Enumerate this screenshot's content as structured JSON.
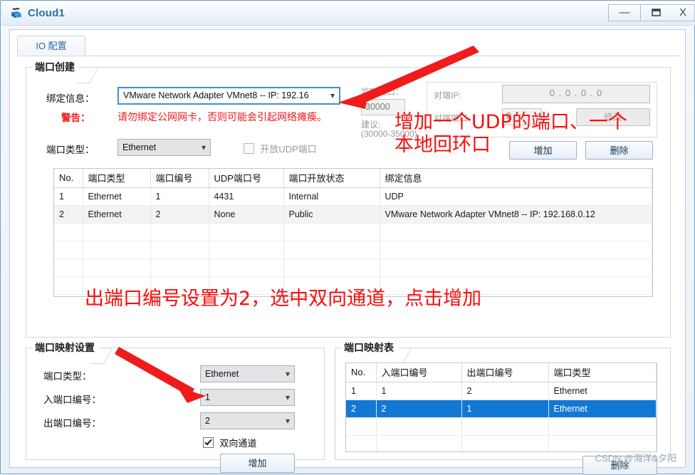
{
  "window": {
    "title": "Cloud1",
    "icon": "cloud-device-icon",
    "minimize_label": "—",
    "maximize_label": "❐",
    "close_label": "X"
  },
  "tabs": [
    {
      "label": "IO 配置",
      "active": true
    }
  ],
  "port_create": {
    "group_title": "端口创建",
    "binding_label": "绑定信息：",
    "binding_value": "VMware Network Adapter VMnet8 -- IP: 192.16",
    "warning_label": "警告：",
    "warning_text": "请勿绑定公网网卡，否则可能会引起网络瘫痪。",
    "port_type_label": "端口类型：",
    "port_type_value": "Ethernet",
    "udp_checkbox_label": "开放UDP端口",
    "udp_checkbox_checked": false,
    "listen_port_label": "监听端口：",
    "listen_port_value": "30000",
    "suggest_label": "建议:",
    "suggest_range": "(30000-35000)",
    "peer_ip_label": "对端IP:",
    "peer_ip_value": "0 . 0 . 0 . 0",
    "peer_port_label": "对端端口:",
    "peer_port_value": "0",
    "modify_button": "修改",
    "add_button": "增加",
    "delete_button": "删除"
  },
  "port_table": {
    "columns": [
      "No.",
      "端口类型",
      "端口编号",
      "UDP端口号",
      "端口开放状态",
      "绑定信息"
    ],
    "rows": [
      [
        "1",
        "Ethernet",
        "1",
        "4431",
        "Internal",
        "UDP"
      ],
      [
        "2",
        "Ethernet",
        "2",
        "None",
        "Public",
        "VMware Network Adapter VMnet8 -- IP: 192.168.0.12"
      ]
    ],
    "empty_rows": 5
  },
  "map_settings": {
    "group_title": "端口映射设置",
    "port_type_label": "端口类型：",
    "port_type_value": "Ethernet",
    "in_port_label": "入端口编号：",
    "in_port_value": "1",
    "out_port_label": "出端口编号：",
    "out_port_value": "2",
    "duplex_label": "双向通道",
    "duplex_checked": true,
    "add_button": "增加"
  },
  "map_table": {
    "group_title": "端口映射表",
    "columns": [
      "No.",
      "入端口编号",
      "出端口编号",
      "端口类型"
    ],
    "rows": [
      {
        "cells": [
          "1",
          "1",
          "2",
          "Ethernet"
        ],
        "selected": false
      },
      {
        "cells": [
          "2",
          "2",
          "1",
          "Ethernet"
        ],
        "selected": true
      }
    ],
    "empty_rows": 3,
    "delete_button": "删除"
  },
  "annotations": {
    "top_line1": "增加一个UDP的端口、一个",
    "top_line2": "本地回环口",
    "middle": "出端口编号设置为2，选中双向通道，点击增加",
    "color": "#fb0d0d"
  },
  "watermark": "CSDN @海洋&夕阳"
}
